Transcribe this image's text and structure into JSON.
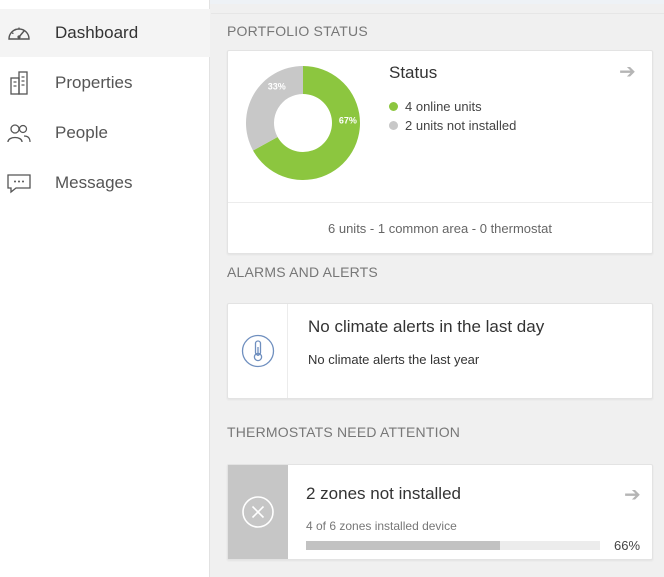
{
  "colors": {
    "online": "#8cc63f",
    "not_installed": "#c8c8c8",
    "accent_arrow": "#b5b5b5"
  },
  "sidebar": {
    "items": [
      {
        "label": "Dashboard",
        "icon": "speedometer-icon",
        "active": true
      },
      {
        "label": "Properties",
        "icon": "buildings-icon",
        "active": false
      },
      {
        "label": "People",
        "icon": "people-icon",
        "active": false
      },
      {
        "label": "Messages",
        "icon": "chat-icon",
        "active": false
      }
    ]
  },
  "portfolio": {
    "section_title": "PORTFOLIO STATUS",
    "card_title": "Status",
    "arrow_icon": "arrow-right-icon",
    "legend": [
      {
        "label": "4 online units",
        "color": "#8cc63f"
      },
      {
        "label": "2 units not installed",
        "color": "#c8c8c8"
      }
    ],
    "donut": {
      "slices": [
        {
          "name": "online",
          "value": 67,
          "label": "67%",
          "color": "#8cc63f"
        },
        {
          "name": "not installed",
          "value": 33,
          "label": "33%",
          "color": "#c8c8c8"
        }
      ]
    },
    "summary": "6 units - 1 common area - 0 thermostat"
  },
  "alarms": {
    "section_title": "ALARMS AND ALERTS",
    "icon": "thermometer-icon",
    "title": "No climate alerts in the last day",
    "subtitle": "No climate alerts the last year"
  },
  "thermostats": {
    "section_title": "THERMOSTATS NEED ATTENTION",
    "icon": "close-circle-icon",
    "title": "2 zones not installed",
    "subtitle": "4 of 6 zones installed device",
    "progress_fraction": 0.66,
    "progress_label": "66%",
    "arrow_icon": "arrow-right-icon"
  }
}
